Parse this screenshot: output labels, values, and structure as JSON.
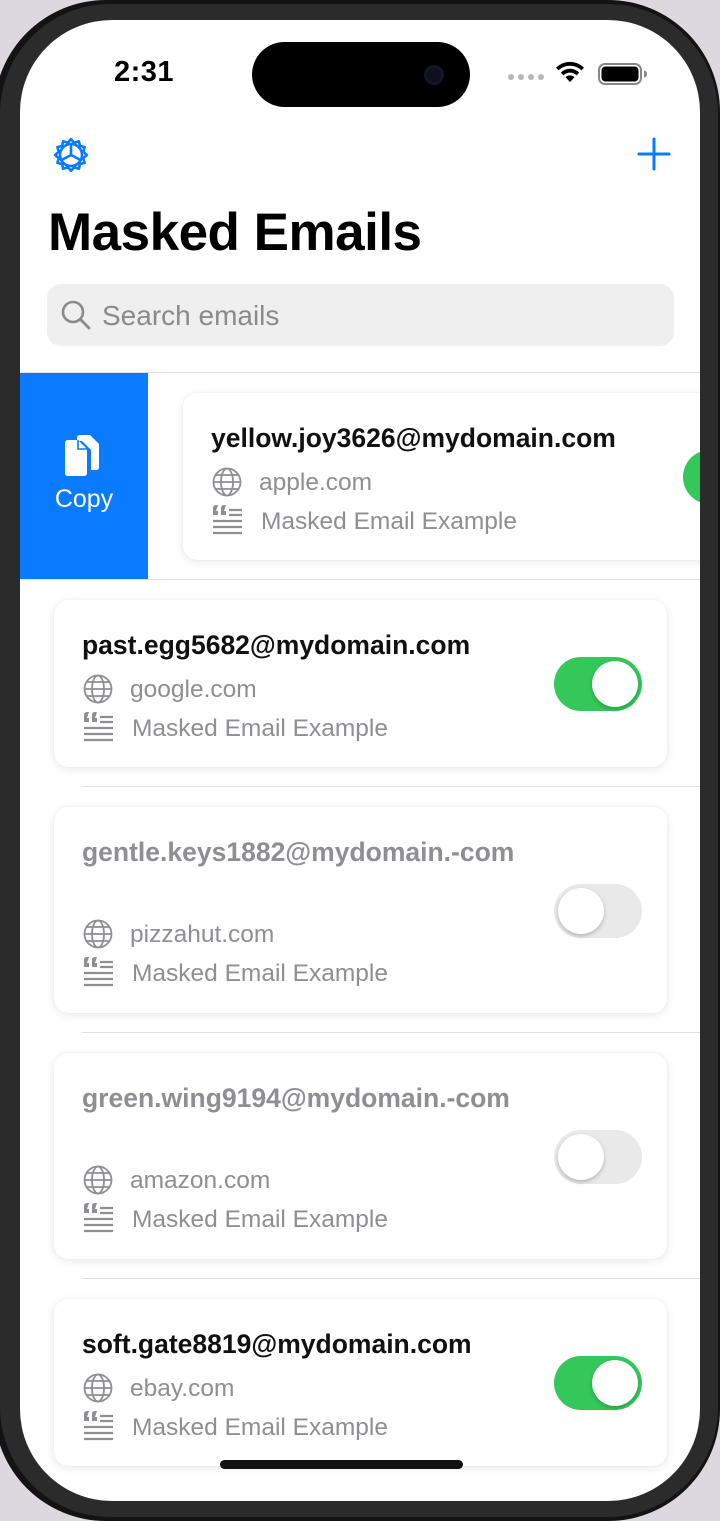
{
  "status_bar": {
    "time": "2:31"
  },
  "header": {
    "title": "Masked Emails"
  },
  "search": {
    "placeholder": "Search emails"
  },
  "swipe_action": {
    "label": "Copy"
  },
  "colors": {
    "accent": "#0a7aff",
    "toggle_on": "#34c759",
    "toggle_off": "#e9e9ea"
  },
  "icons": {
    "settings": "gear-icon",
    "add": "plus-icon",
    "search": "search-icon",
    "domain": "globe-icon",
    "description": "quote-icon",
    "copy": "copy-icon"
  },
  "emails": [
    {
      "address": "yellow.joy3626@mydomain.com",
      "domain": "apple.com",
      "description": "Masked Email Example",
      "enabled": true
    },
    {
      "address": "past.egg5682@mydomain.com",
      "domain": "google.com",
      "description": "Masked Email Example",
      "enabled": true
    },
    {
      "address": "gentle.keys1882@mydomain.-com",
      "domain": "pizzahut.com",
      "description": "Masked Email Example",
      "enabled": false
    },
    {
      "address": "green.wing9194@mydomain.-com",
      "domain": "amazon.com",
      "description": "Masked Email Example",
      "enabled": false
    },
    {
      "address": "soft.gate8819@mydomain.com",
      "domain": "ebay.com",
      "description": "Masked Email Example",
      "enabled": true
    }
  ]
}
